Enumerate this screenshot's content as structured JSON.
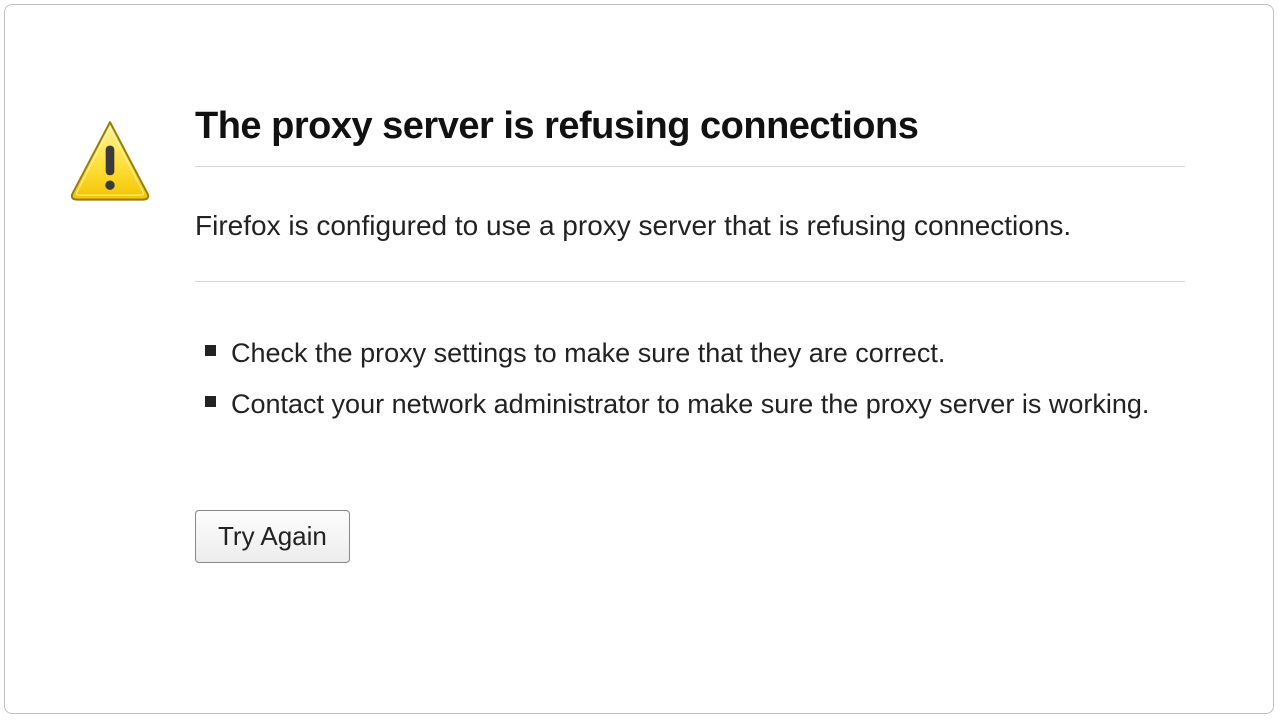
{
  "error": {
    "title": "The proxy server is refusing connections",
    "description": "Firefox is configured to use a proxy server that is refusing connections.",
    "tips": [
      "Check the proxy settings to make sure that they are correct.",
      "Contact your network administrator to make sure the proxy server is working."
    ],
    "try_again_label": "Try Again"
  },
  "colors": {
    "warning_fill": "#ffde3c",
    "warning_stroke": "#b08400"
  }
}
